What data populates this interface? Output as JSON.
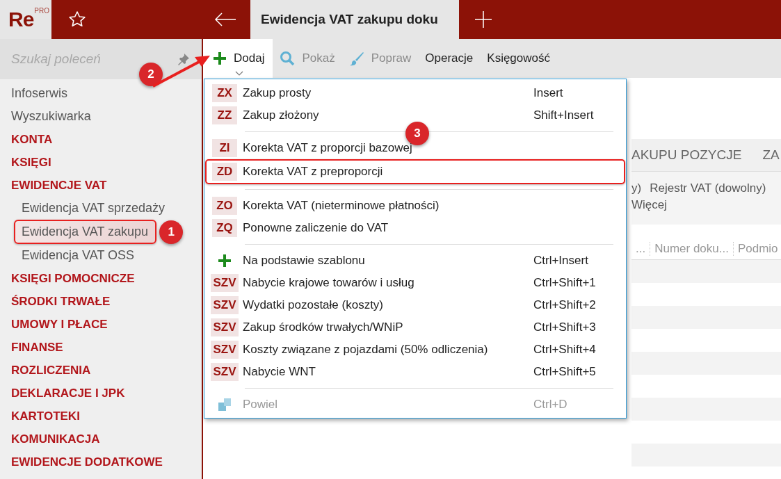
{
  "logo": {
    "text": "Re",
    "badge": "PRO"
  },
  "tab": {
    "title": "Ewidencja VAT zakupu doku"
  },
  "sidebar": {
    "search": {
      "placeholder": "Szukaj poleceń"
    },
    "items": [
      {
        "kind": "link",
        "label": "Infoserwis",
        "highlighted": false
      },
      {
        "kind": "link",
        "label": "Wyszukiwarka",
        "highlighted": false
      },
      {
        "kind": "section",
        "label": "KONTA",
        "highlighted": false
      },
      {
        "kind": "section",
        "label": "KSIĘGI",
        "highlighted": false
      },
      {
        "kind": "section",
        "label": "EWIDENCJE VAT",
        "highlighted": false,
        "children": [
          {
            "kind": "sub",
            "label": "Ewidencja VAT sprzedaży",
            "highlighted": false
          },
          {
            "kind": "sub",
            "label": "Ewidencja VAT zakupu",
            "highlighted": true,
            "marker": "1"
          },
          {
            "kind": "sub",
            "label": "Ewidencja VAT OSS",
            "highlighted": false
          }
        ]
      },
      {
        "kind": "section",
        "label": "KSIĘGI POMOCNICZE",
        "highlighted": false
      },
      {
        "kind": "section",
        "label": "ŚRODKI TRWAŁE",
        "highlighted": false
      },
      {
        "kind": "section",
        "label": "UMOWY I PŁACE",
        "highlighted": false
      },
      {
        "kind": "section",
        "label": "FINANSE",
        "highlighted": false
      },
      {
        "kind": "section",
        "label": "ROZLICZENIA",
        "highlighted": false
      },
      {
        "kind": "section",
        "label": "DEKLARACJE I JPK",
        "highlighted": false
      },
      {
        "kind": "section",
        "label": "KARTOTEKI",
        "highlighted": false
      },
      {
        "kind": "section",
        "label": "KOMUNIKACJA",
        "highlighted": false
      },
      {
        "kind": "section",
        "label": "EWIDENCJE DODATKOWE",
        "highlighted": false
      }
    ]
  },
  "toolbar": [
    {
      "kind": "add",
      "label": "Dodaj",
      "selected": true,
      "disabled": false,
      "marker": "2"
    },
    {
      "kind": "search",
      "label": "Pokaż",
      "selected": false,
      "disabled": true
    },
    {
      "kind": "brush",
      "label": "Popraw",
      "selected": false,
      "disabled": true
    },
    {
      "kind": "text",
      "label": "Operacje",
      "selected": false,
      "disabled": false
    },
    {
      "kind": "text",
      "label": "Księgowość",
      "selected": false,
      "disabled": false
    }
  ],
  "content": {
    "tabs": [
      "AKUPU POZYCJE",
      "ZA"
    ],
    "filters": [
      [
        "y)",
        "Rejestr VAT (dowolny)"
      ],
      [
        "Więcej"
      ]
    ],
    "columns": [
      "...",
      "Numer doku...",
      "Podmio"
    ]
  },
  "menu": {
    "groups": [
      [
        {
          "kind": "code",
          "code": "ZX",
          "label": "Zakup prosty",
          "shortcut": "Insert",
          "disabled": false,
          "highlighted": false
        },
        {
          "kind": "code",
          "code": "ZZ",
          "label": "Zakup złożony",
          "shortcut": "Shift+Insert",
          "disabled": false,
          "highlighted": false
        }
      ],
      [
        {
          "kind": "code",
          "code": "ZI",
          "label": "Korekta VAT z proporcji bazowej",
          "disabled": false,
          "highlighted": false
        },
        {
          "kind": "code",
          "code": "ZD",
          "label": "Korekta VAT z preproporcji",
          "disabled": false,
          "highlighted": true,
          "marker": "3"
        }
      ],
      [
        {
          "kind": "code",
          "code": "ZO",
          "label": "Korekta VAT (nieterminowe płatności)",
          "disabled": false,
          "highlighted": false
        },
        {
          "kind": "code",
          "code": "ZQ",
          "label": "Ponowne zaliczenie do VAT",
          "disabled": false,
          "highlighted": false
        }
      ],
      [
        {
          "kind": "plus",
          "label": "Na podstawie szablonu",
          "shortcut": "Ctrl+Insert",
          "disabled": false,
          "highlighted": false
        },
        {
          "kind": "code",
          "code": "SZV",
          "label": "Nabycie krajowe towarów i usług",
          "shortcut": "Ctrl+Shift+1",
          "disabled": false,
          "highlighted": false
        },
        {
          "kind": "code",
          "code": "SZV",
          "label": "Wydatki pozostałe (koszty)",
          "shortcut": "Ctrl+Shift+2",
          "disabled": false,
          "highlighted": false
        },
        {
          "kind": "code",
          "code": "SZV",
          "label": "Zakup środków trwałych/WNiP",
          "shortcut": "Ctrl+Shift+3",
          "disabled": false,
          "highlighted": false
        },
        {
          "kind": "code",
          "code": "SZV",
          "label": "Koszty związane z pojazdami (50% odliczenia)",
          "shortcut": "Ctrl+Shift+4",
          "disabled": false,
          "highlighted": false
        },
        {
          "kind": "code",
          "code": "SZV",
          "label": "Nabycie WNT",
          "shortcut": "Ctrl+Shift+5",
          "disabled": false,
          "highlighted": false
        }
      ],
      [
        {
          "kind": "copy",
          "label": "Powiel",
          "shortcut": "Ctrl+D",
          "disabled": true,
          "highlighted": false
        }
      ]
    ]
  }
}
